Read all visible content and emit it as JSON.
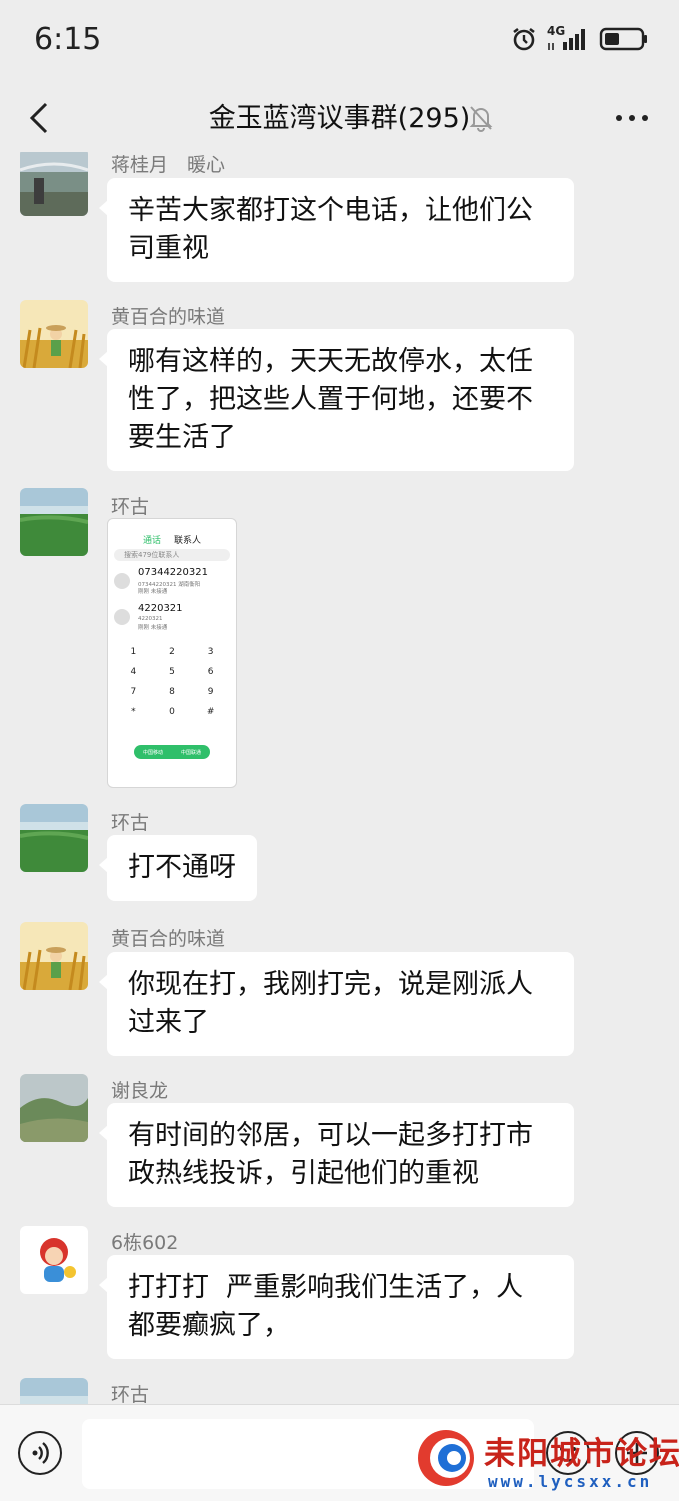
{
  "status_bar": {
    "time": "6:15",
    "network": "4G",
    "icons": [
      "alarm-icon",
      "signal-icon",
      "battery-icon"
    ]
  },
  "header": {
    "title": "金玉蓝湾议事群(295)",
    "icons": [
      "back-icon",
      "mute-bell-icon",
      "more-icon"
    ]
  },
  "messages": [
    {
      "sender": "蒋桂月　暖心",
      "text": "辛苦大家都打这个电话，让他们公司重视",
      "lines": [
        "辛苦大家都打这个电话，让他们公",
        "司重视"
      ]
    },
    {
      "sender": "黄百合的味道",
      "text": "哪有这样的，天天无故停水，太任性了，把这些人置于何地，还要不要生活了",
      "lines": [
        "哪有这样的，天天无故停水，太任",
        "性了，把这些人置于何地，还要不",
        "要生活了"
      ]
    },
    {
      "sender": "环古",
      "type": "image",
      "image": {
        "tabs": [
          "通话",
          "联系人"
        ],
        "search": "搜索479位联系人",
        "calls": [
          {
            "number": "07344220321",
            "sub": "07344220321 湖南衡阳",
            "status": "刚刚 未接通"
          },
          {
            "number": "4220321",
            "sub": "4220321",
            "status": "刚刚 未接通"
          }
        ],
        "keypad": [
          "1",
          "2",
          "3",
          "4",
          "5",
          "6",
          "7",
          "8",
          "9",
          "*",
          "0",
          "#"
        ],
        "call_buttons": [
          "中国移动",
          "中国联通"
        ]
      }
    },
    {
      "sender": "环古",
      "text": "打不通呀",
      "lines": [
        "打不通呀"
      ]
    },
    {
      "sender": "黄百合的味道",
      "text": "你现在打，我刚打完，说是刚派人过来了",
      "lines": [
        "你现在打，我刚打完，说是刚派人",
        "过来了"
      ]
    },
    {
      "sender": "谢良龙",
      "text": "有时间的邻居，可以一起多打打市政热线投诉，引起他们的重视",
      "lines": [
        "有时间的邻居，可以一起多打打市",
        "政热线投诉，引起他们的重视"
      ]
    },
    {
      "sender": "6栋602",
      "text": "打打打 严重影响我们生活了，人都要癫疯了，",
      "lines": [
        "打打打  严重影响我们生活了，人",
        "都要癫疯了，"
      ]
    },
    {
      "sender": "环古"
    }
  ],
  "input_bar": {
    "icons": [
      "voice-icon",
      "emoji-icon",
      "plus-icon"
    ]
  },
  "watermark": {
    "title": "耒阳城市论坛",
    "url": "www.lycsxx.cn"
  },
  "colors": {
    "background": "#ededed",
    "bubble": "#ffffff",
    "sender": "#7a7a7a",
    "call_green": "#2fbf6a"
  }
}
